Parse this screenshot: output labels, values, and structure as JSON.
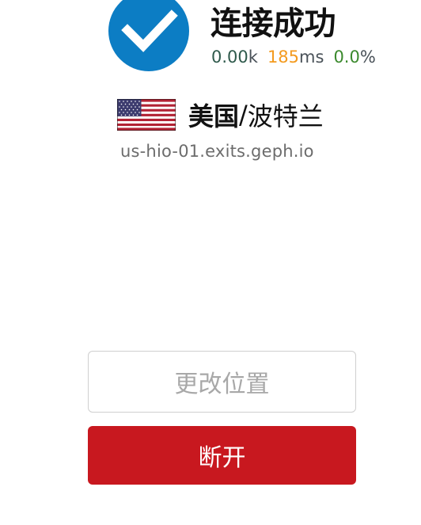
{
  "status": {
    "title": "连接成功",
    "icon": "check-circle-icon",
    "color": "#0c7dc4"
  },
  "stats": {
    "bandwidth_value": "0.00",
    "bandwidth_unit": "k",
    "latency_value": "185",
    "latency_unit": "ms",
    "loss_value": "0.0",
    "loss_unit": "%"
  },
  "location": {
    "flag": "us-flag-icon",
    "country": "美国",
    "separator": "/",
    "city": "波特兰",
    "hostname": "us-hio-01.exits.geph.io"
  },
  "actions": {
    "change_label": "更改位置",
    "disconnect_label": "断开"
  },
  "colors": {
    "accent": "#0c7dc4",
    "disconnect": "#c8181f",
    "latency": "#f39a1e",
    "loss": "#3c8a2e",
    "bandwidth": "#2f5a4c"
  }
}
